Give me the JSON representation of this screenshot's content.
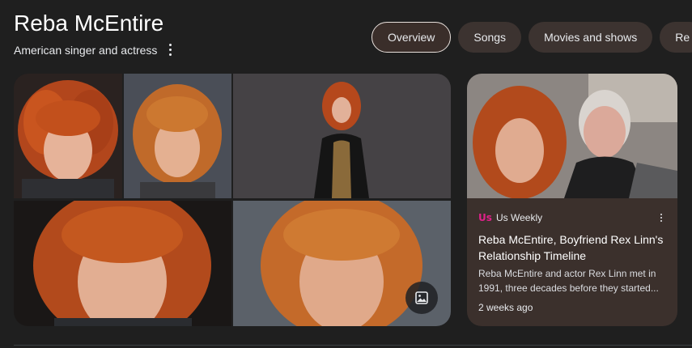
{
  "header": {
    "title": "Reba McEntire",
    "subtitle": "American singer and actress"
  },
  "tabs": [
    {
      "label": "Overview",
      "active": true
    },
    {
      "label": "Songs",
      "active": false
    },
    {
      "label": "Movies and shows",
      "active": false
    },
    {
      "label": "Re",
      "active": false
    }
  ],
  "news_card": {
    "source_logo": "Us",
    "source_name": "Us Weekly",
    "headline": "Reba McEntire, Boyfriend Rex Linn's Relationship Timeline",
    "snippet": "Reba McEntire and actor Rex Linn met in 1991, three decades before they started...",
    "time": "2 weeks ago"
  },
  "icons": {
    "more": "more-vert-icon",
    "image_search": "image-search-icon"
  },
  "colors": {
    "background": "#1f1f1f",
    "tab_background": "#3c3330",
    "card_background": "#3b302c",
    "source_accent": "#e0218a"
  }
}
